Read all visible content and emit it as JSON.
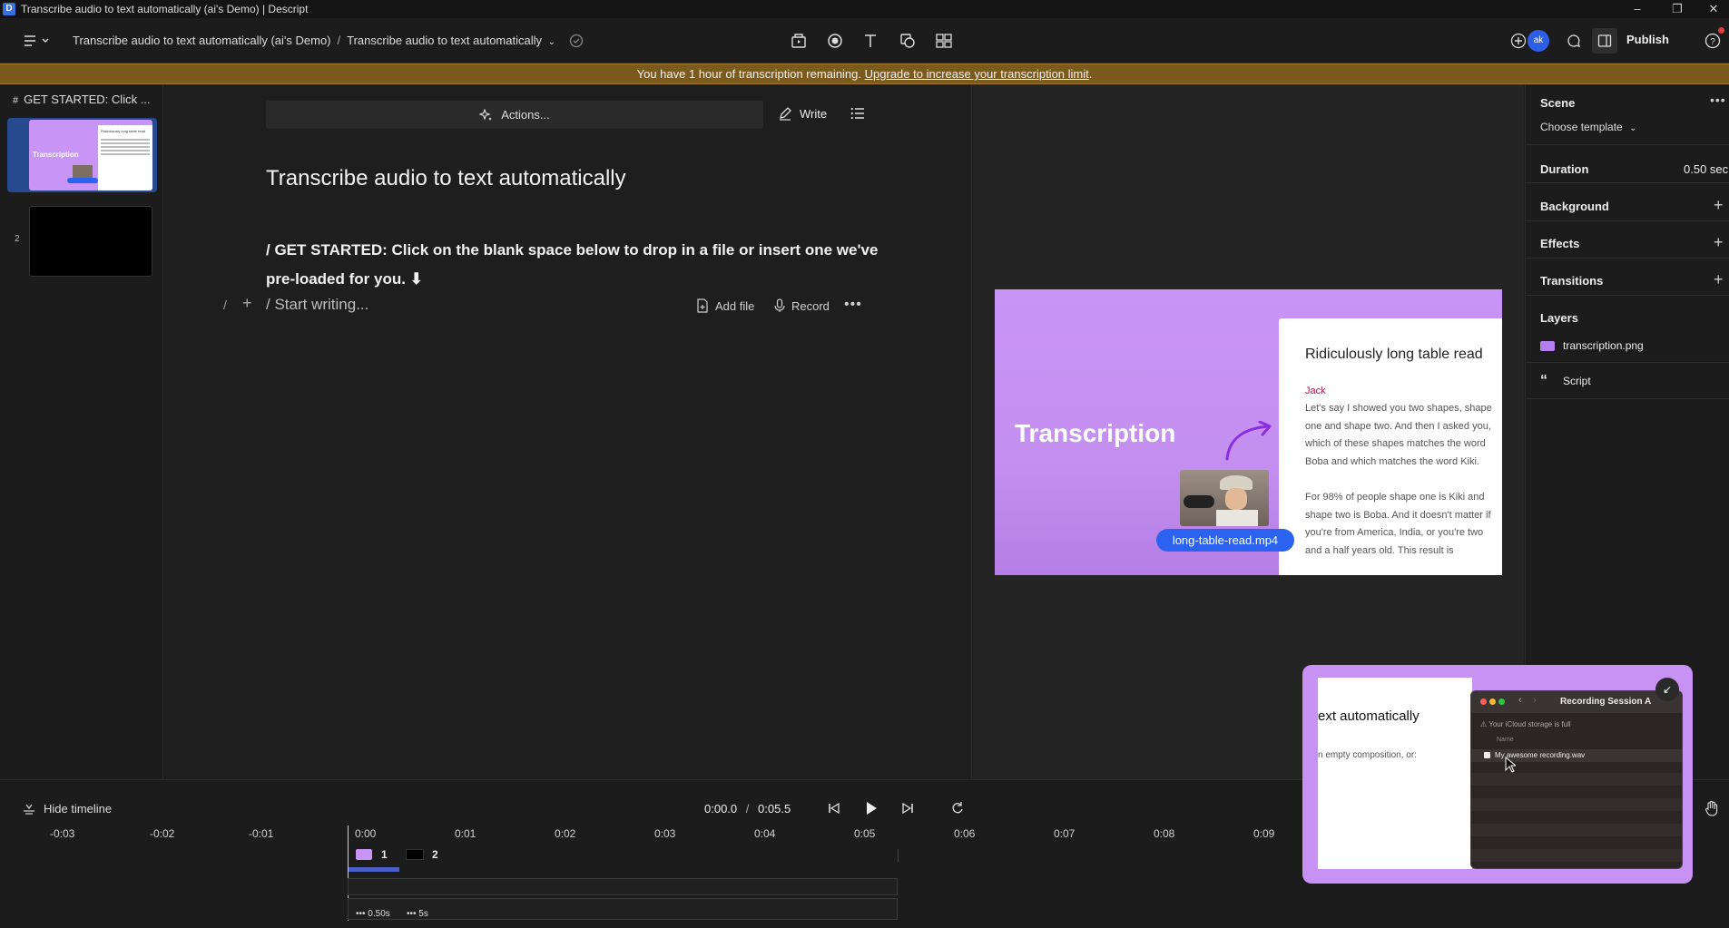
{
  "window": {
    "title": "Transcribe audio to text automatically (ai's Demo) | Descript",
    "app_icon": "D"
  },
  "toolbar": {
    "breadcrumb_project": "Transcribe audio to text automatically (ai's Demo)",
    "breadcrumb_separator": "/",
    "breadcrumb_composition": "Transcribe audio to text automatically",
    "publish_label": "Publish",
    "avatar_initials": "ak"
  },
  "banner": {
    "text": "You have 1 hour of transcription remaining.",
    "link": "Upgrade to increase your transcription limit",
    "end": "."
  },
  "scenes": {
    "header": "GET STARTED: Click ...",
    "header_icon": "#",
    "items": [
      {
        "number": "1",
        "thumb_title": "Transcription",
        "thumb_heading": "Ridiculously long table read"
      },
      {
        "number": "2"
      }
    ]
  },
  "editor": {
    "actions_label": "Actions...",
    "write_label": "Write",
    "title": "Transcribe audio to text automatically",
    "body": "/ GET STARTED: Click on the blank space below to drop in a file or insert one we've pre-loaded for you. ⬇",
    "start_writing": "/ Start writing...",
    "slash": "/",
    "add_file_label": "Add file",
    "record_label": "Record"
  },
  "canvas": {
    "scene_title": "Transcription",
    "doc_heading": "Ridiculously long table read",
    "speaker": "Jack",
    "paragraph1": "Let's say I showed you two shapes, shape one and shape two. And then I asked you, which of these shapes matches the word Boba and which matches the word Kiki.",
    "paragraph2": "For 98% of people shape one is Kiki and shape two is Boba. And it doesn't matter if you're from America, India, or you're two and a half years old. This result is",
    "clip_label": "long-table-read.mp4"
  },
  "properties": {
    "scene_label": "Scene",
    "choose_template": "Choose template",
    "duration_label": "Duration",
    "duration_value": "0.50 sec",
    "background_label": "Background",
    "effects_label": "Effects",
    "transitions_label": "Transitions",
    "layers_label": "Layers",
    "layers": [
      {
        "name": "transcription.png",
        "icon": "image-icon"
      },
      {
        "name": "Script",
        "icon": "quote-icon"
      }
    ]
  },
  "timeline": {
    "hide_label": "Hide timeline",
    "current_time": "0:00.0",
    "separator": "/",
    "total_time": "0:05.5",
    "ticks": [
      "-0:03",
      "-0:02",
      "-0:01",
      "0:00",
      "0:01",
      "0:02",
      "0:03",
      "0:04",
      "0:05",
      "0:06",
      "0:07",
      "0:08",
      "0:09"
    ],
    "scene_markers": [
      "1",
      "2"
    ],
    "durations": [
      "0.50s",
      "5s"
    ]
  },
  "overlay": {
    "doc_text": "ext automatically",
    "doc_sub": "n empty composition, or:",
    "window_title": "Recording Session A",
    "storage_warning": "Your iCloud storage is full",
    "column_name": "Name",
    "file_name": "My awesome recording.wav"
  }
}
